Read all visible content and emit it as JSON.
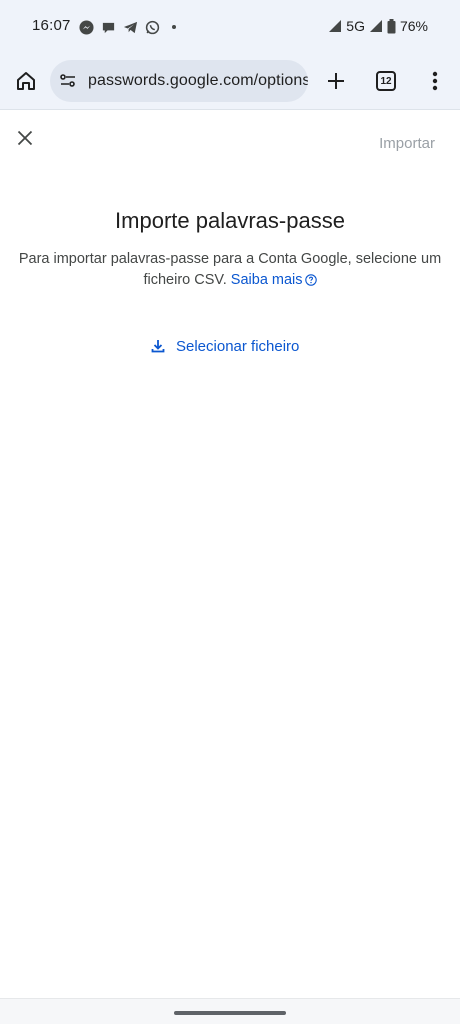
{
  "status_bar": {
    "time": "16:07",
    "network": "5G",
    "battery": "76%",
    "notification_icons": [
      "messenger-icon",
      "chat-bubble-icon",
      "telegram-icon",
      "whatsapp-icon",
      "dot-icon"
    ]
  },
  "browser": {
    "url": "passwords.google.com/options",
    "tab_count": "12"
  },
  "dialog": {
    "import_label": "Importar",
    "title": "Importe palavras-passe",
    "description": "Para importar palavras-passe para a Conta Google, selecione um ficheiro CSV.",
    "learn_more": "Saiba mais",
    "select_file_label": "Selecionar ficheiro"
  },
  "colors": {
    "accent": "#0b57d0",
    "disabled": "#9aa0a6",
    "chrome_bg": "#eff3fa"
  }
}
